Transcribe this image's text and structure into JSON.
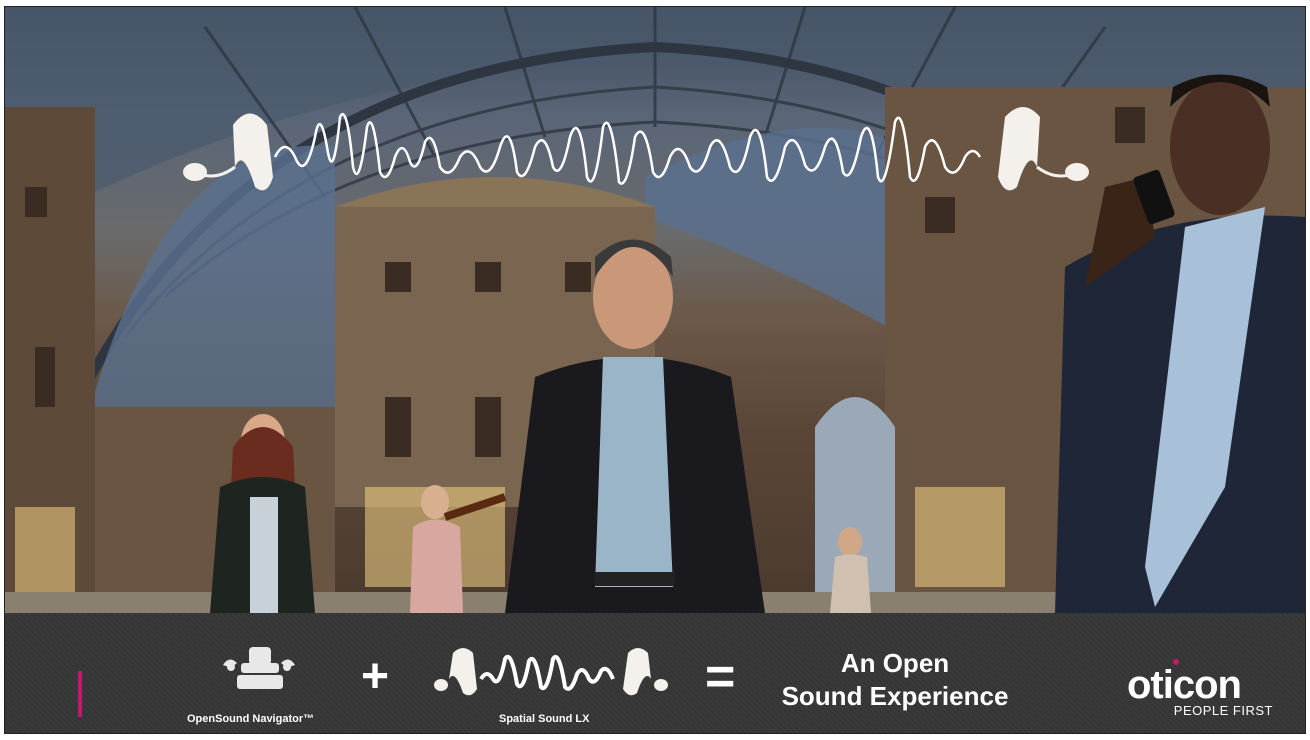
{
  "slide": {
    "photo": {
      "description_icon": "galleria-crowd-photo"
    },
    "footer": {
      "item1": {
        "icon": "brain-processor-icon",
        "label": "OpenSound Navigator™"
      },
      "plus": "+",
      "item2": {
        "icon": "hearing-aid-wave-icon",
        "label": "Spatial Sound LX"
      },
      "equals": "=",
      "result_line1": "An Open",
      "result_line2": "Sound Experience",
      "brand_name": "oticon",
      "brand_tagline": "PEOPLE FIRST"
    },
    "colors": {
      "accent": "#c2186d",
      "bar": "#3a3a3a",
      "text": "#ffffff"
    }
  }
}
